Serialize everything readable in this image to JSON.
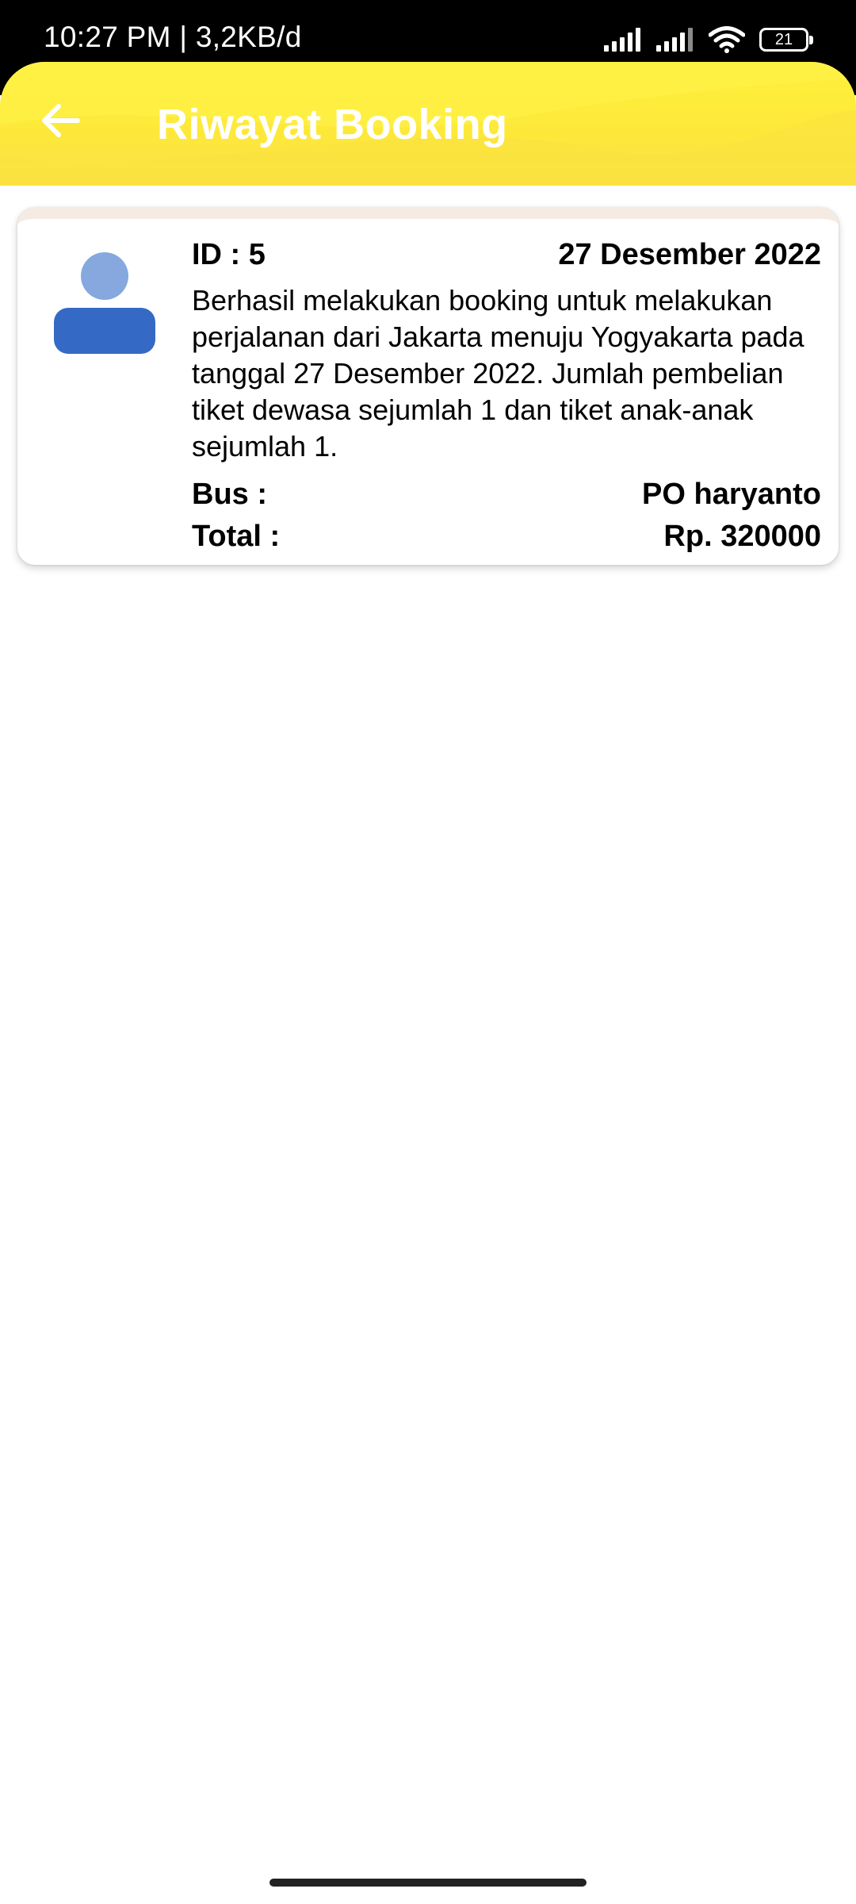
{
  "status_bar": {
    "time_speed": "10:27 PM | 3,2KB/d",
    "battery_level": "21",
    "icons": [
      "signal-icon",
      "signal-icon",
      "wifi-icon",
      "battery-icon"
    ]
  },
  "app_bar": {
    "back_icon": "arrow-left-icon",
    "title": "Riwayat Booking",
    "color": "#fde83a"
  },
  "bookings": [
    {
      "avatar_icon": "person-icon",
      "id_label": "ID : 5",
      "date": "27 Desember 2022",
      "description": "Berhasil melakukan booking untuk melakukan perjalanan dari Jakarta menuju Yogyakarta pada tanggal 27 Desember 2022. Jumlah pembelian tiket dewasa sejumlah 1 dan tiket anak-anak sejumlah 1.",
      "bus_label": "Bus :",
      "bus_value": "PO haryanto",
      "total_label": "Total :",
      "total_value": "Rp. 320000"
    }
  ]
}
